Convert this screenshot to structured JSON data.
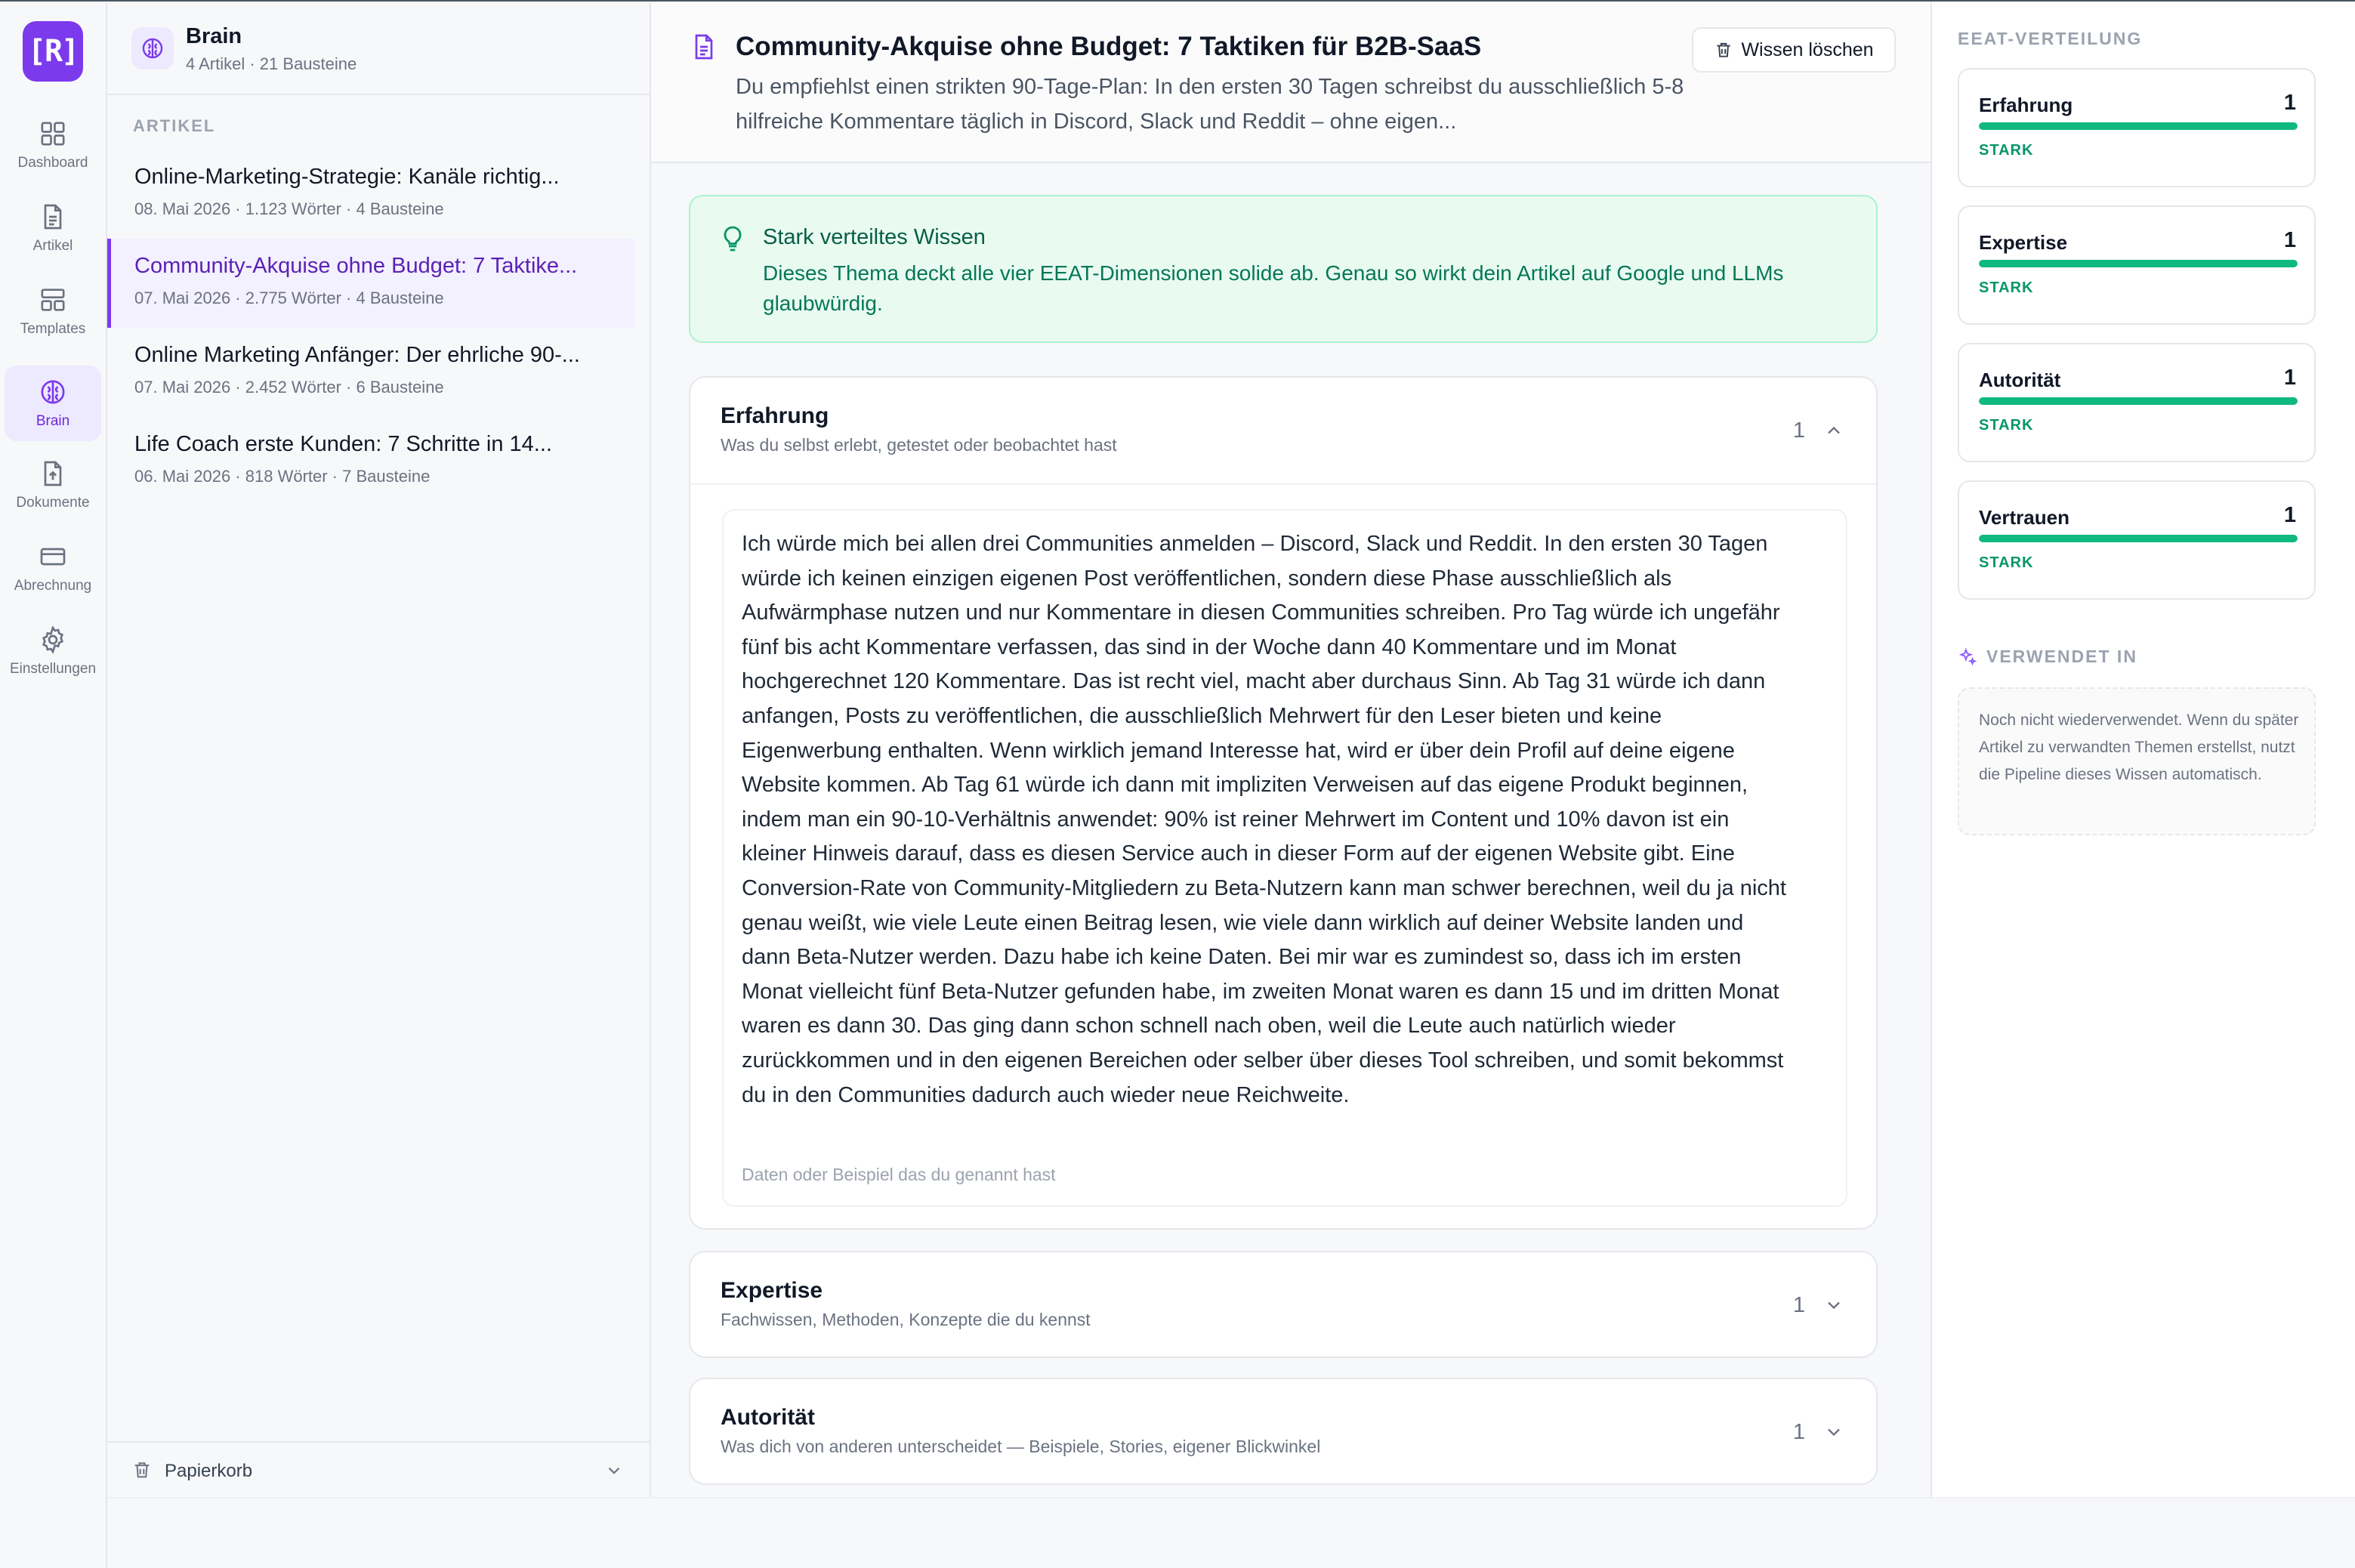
{
  "rail": {
    "logo": "[R]",
    "items": [
      {
        "label": "Dashboard",
        "icon": "dashboard-icon"
      },
      {
        "label": "Artikel",
        "icon": "document-icon"
      },
      {
        "label": "Templates",
        "icon": "templates-icon"
      },
      {
        "label": "Brain",
        "icon": "brain-icon",
        "active": true
      },
      {
        "label": "Dokumente",
        "icon": "upload-file-icon"
      },
      {
        "label": "Abrechnung",
        "icon": "credit-card-icon"
      },
      {
        "label": "Einstellungen",
        "icon": "gear-icon"
      }
    ]
  },
  "brain": {
    "title": "Brain",
    "subtitle": "4 Artikel · 21 Bausteine",
    "section_label": "ARTIKEL",
    "articles": [
      {
        "title": "Online-Marketing-Strategie: Kanäle richtig...",
        "meta": "08. Mai 2026 · 1.123 Wörter · 4 Bausteine"
      },
      {
        "title": "Community-Akquise ohne Budget: 7 Taktike...",
        "meta": "07. Mai 2026 · 2.775 Wörter · 4 Bausteine",
        "active": true
      },
      {
        "title": "Online Marketing Anfänger: Der ehrliche 90-...",
        "meta": "07. Mai 2026 · 2.452 Wörter · 6 Bausteine"
      },
      {
        "title": "Life Coach erste Kunden: 7 Schritte in 14...",
        "meta": "06. Mai 2026 · 818 Wörter · 7 Bausteine"
      }
    ],
    "trash_label": "Papierkorb"
  },
  "main": {
    "title": "Community-Akquise ohne Budget: 7 Taktiken für B2B-SaaS",
    "excerpt": "Du empfiehlst einen strikten 90-Tage-Plan: In den ersten 30 Tagen schreibst du ausschließlich 5-8 hilfreiche Kommentare täglich in Discord, Slack und Reddit – ohne eigen...",
    "delete_label": "Wissen löschen",
    "notice": {
      "title": "Stark verteiltes Wissen",
      "text": "Dieses Thema deckt alle vier EEAT-Dimensionen solide ab. Genau so wirkt dein Artikel auf Google und LLMs glaubwürdig."
    },
    "sections": [
      {
        "title": "Erfahrung",
        "subtitle": "Was du selbst erlebt, getestet oder beobachtet hast",
        "count": "1",
        "expanded": true,
        "entry": "Ich würde mich bei allen drei Communities anmelden – Discord, Slack und Reddit. In den ersten 30 Tagen würde ich keinen einzigen eigenen Post veröffentlichen, sondern diese Phase ausschließlich als Aufwärmphase nutzen und nur Kommentare in diesen Communities schreiben. Pro Tag würde ich ungefähr fünf bis acht Kommentare verfassen, das sind in der Woche dann 40 Kommentare und im Monat hochgerechnet 120 Kommentare. Das ist recht viel, macht aber durchaus Sinn. Ab Tag 31 würde ich dann anfangen, Posts zu veröffentlichen, die ausschließlich Mehrwert für den Leser bieten und keine Eigenwerbung enthalten. Wenn wirklich jemand Interesse hat, wird er über dein Profil auf deine eigene Website kommen. Ab Tag 61 würde ich dann mit impliziten Verweisen auf das eigene Produkt beginnen, indem man ein 90-10-Verhältnis anwendet: 90% ist reiner Mehrwert im Content und 10% davon ist ein kleiner Hinweis darauf, dass es diesen Service auch in dieser Form auf der eigenen Website gibt. Eine Conversion-Rate von Community-Mitgliedern zu Beta-Nutzern kann man schwer berechnen, weil du ja nicht genau weißt, wie viele Leute einen Beitrag lesen, wie viele dann wirklich auf deiner Website landen und dann Beta-Nutzer werden. Dazu habe ich keine Daten. Bei mir war es zumindest so, dass ich im ersten Monat vielleicht fünf Beta-Nutzer gefunden habe, im zweiten Monat waren es dann 15 und im dritten Monat waren es dann 30. Das ging dann schon schnell nach oben, weil die Leute auch natürlich wieder zurückkommen und in den eigenen Bereichen oder selber über dieses Tool schreiben, und somit bekommst du in den Communities dadurch auch wieder neue Reichweite.",
        "entry_note": "Daten oder Beispiel das du genannt hast"
      },
      {
        "title": "Expertise",
        "subtitle": "Fachwissen, Methoden, Konzepte die du kennst",
        "count": "1",
        "expanded": false
      },
      {
        "title": "Autorität",
        "subtitle": "Was dich von anderen unterscheidet — Beispiele, Stories, eigener Blickwinkel",
        "count": "1",
        "expanded": false
      }
    ]
  },
  "eeat": {
    "label": "EEAT-VERTEILUNG",
    "items": [
      {
        "name": "Erfahrung",
        "value": "1",
        "level": "STARK",
        "fill": 1.0
      },
      {
        "name": "Expertise",
        "value": "1",
        "level": "STARK",
        "fill": 1.0
      },
      {
        "name": "Autorität",
        "value": "1",
        "level": "STARK",
        "fill": 1.0
      },
      {
        "name": "Vertrauen",
        "value": "1",
        "level": "STARK",
        "fill": 1.0
      }
    ],
    "used_label": "VERWENDET IN",
    "used_text": "Noch nicht wiederverwendet. Wenn du später Artikel zu verwandten Themen erstellst, nutzt die Pipeline dieses Wissen automatisch."
  },
  "colors": {
    "accent": "#7c3aed",
    "success": "#10b981",
    "success_text": "#059669"
  }
}
